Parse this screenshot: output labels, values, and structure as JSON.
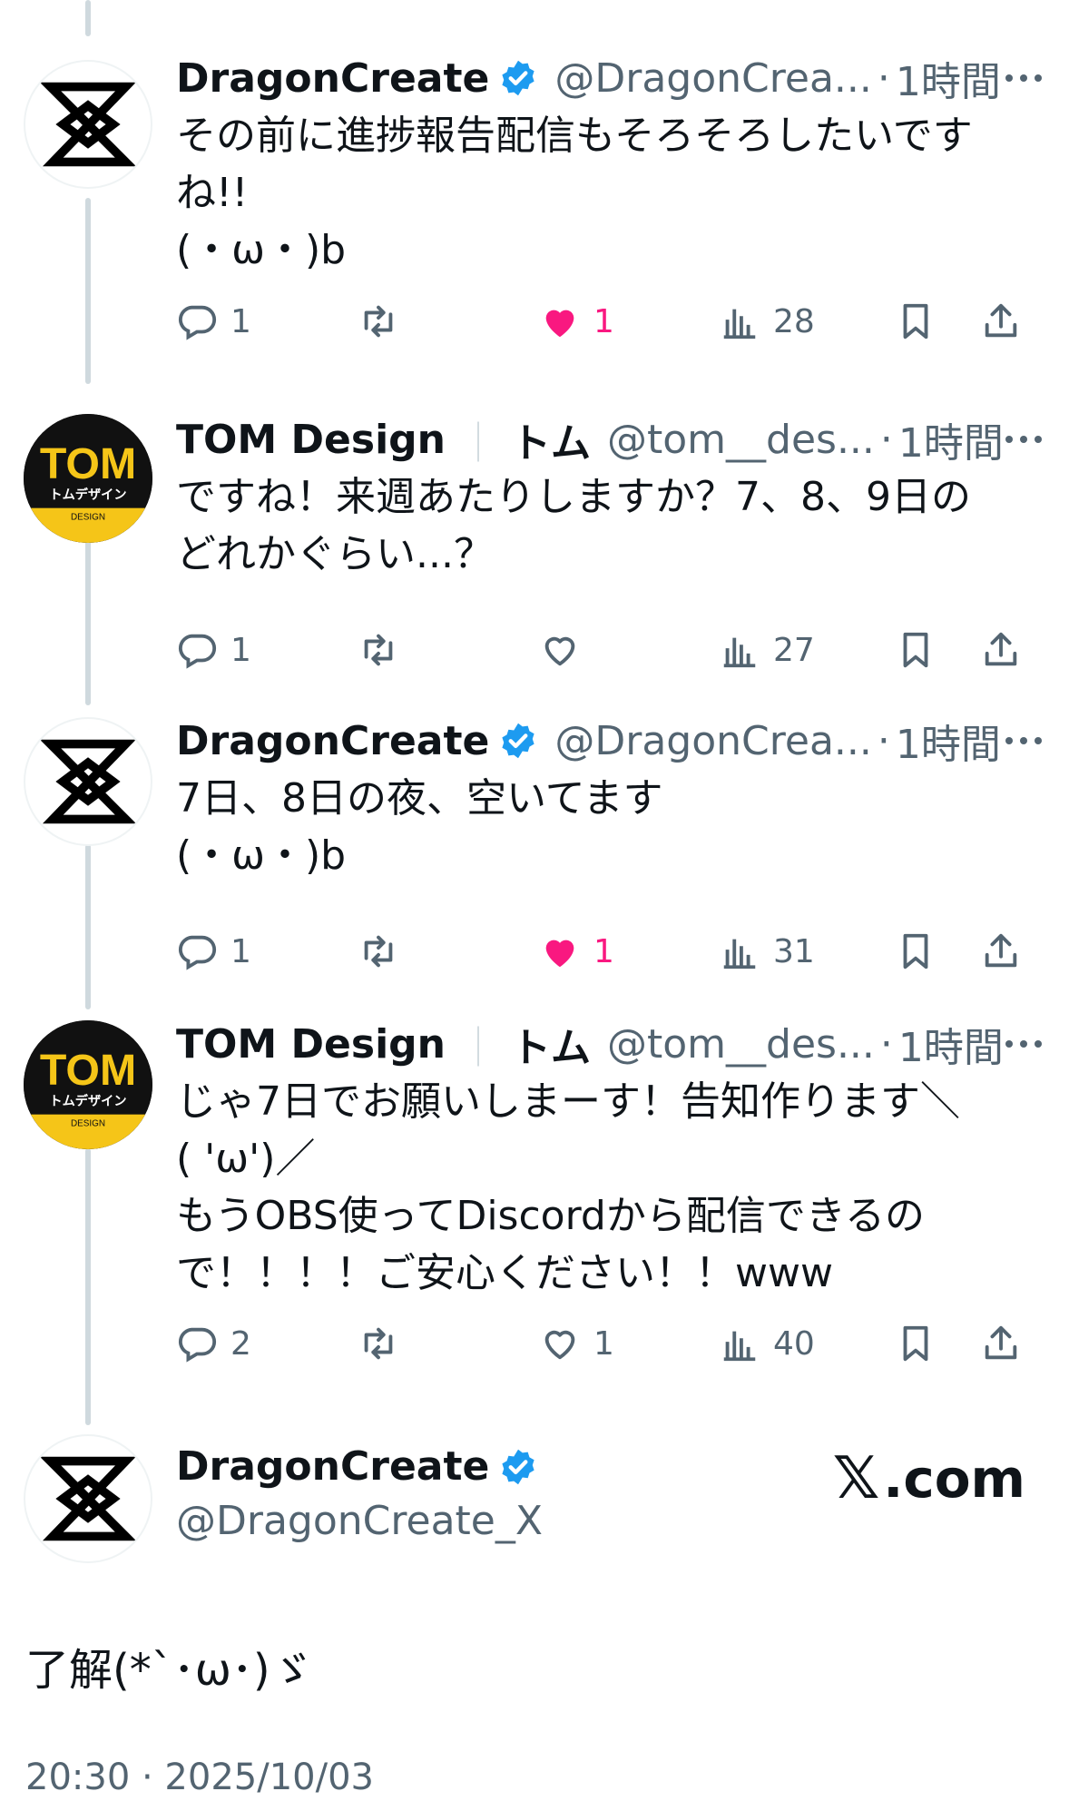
{
  "tweets": [
    {
      "name": "DragonCreate",
      "verified": true,
      "handle": "@DragonCrea...",
      "dot": "·",
      "time": "1時間",
      "text": "その前に進捗報告配信もそろそろしたいです\nね!!\n(・ω・)b",
      "replies": "1",
      "retweets": "",
      "likes": "1",
      "liked": true,
      "views": "28"
    },
    {
      "name": "TOM Design",
      "sep": "｜",
      "katakana": "トム",
      "verified": false,
      "handle": "@tom__des...",
      "dot": "·",
      "time": "1時間",
      "text": "ですね！来週あたりしますか？7、8、9日の\nどれかぐらい...？",
      "replies": "1",
      "retweets": "",
      "likes": "",
      "liked": false,
      "views": "27"
    },
    {
      "name": "DragonCreate",
      "verified": true,
      "handle": "@DragonCrea...",
      "dot": "·",
      "time": "1時間",
      "text": "7日、8日の夜、空いてます\n(・ω・)b",
      "replies": "1",
      "retweets": "",
      "likes": "1",
      "liked": true,
      "views": "31"
    },
    {
      "name": "TOM Design",
      "sep": "｜",
      "katakana": "トム",
      "verified": false,
      "handle": "@tom__des...",
      "dot": "·",
      "time": "1時間",
      "text": "じゃ7日でお願いしまーす！告知作ります＼\n( 'ω')／\nもうOBS使ってDiscordから配信できるの\nで！！！！ご安心ください！！www",
      "replies": "2",
      "retweets": "",
      "likes": "1",
      "liked": false,
      "views": "40"
    }
  ],
  "footer": {
    "name": "DragonCreate",
    "handle": "@DragonCreate_X",
    "brand_mark": "𝕏",
    "brand_text": ".com",
    "text": "了解(*`･ω･)ゞ",
    "timestamp": "20:30 · 2025/10/03"
  },
  "avatar_logo_text": {
    "top": "TOM",
    "middle": "トムデザイン",
    "bottom": "DESIGN"
  },
  "colors": {
    "like": "#f91880",
    "verified": "#1d9bf0",
    "secondary": "#536471",
    "line": "#cfd9de",
    "tom_yellow": "#f5c518"
  },
  "icons": [
    "reply-icon",
    "retweet-icon",
    "heart-icon",
    "views-icon",
    "bookmark-icon",
    "share-icon",
    "more-icon",
    "verified-badge-icon"
  ]
}
